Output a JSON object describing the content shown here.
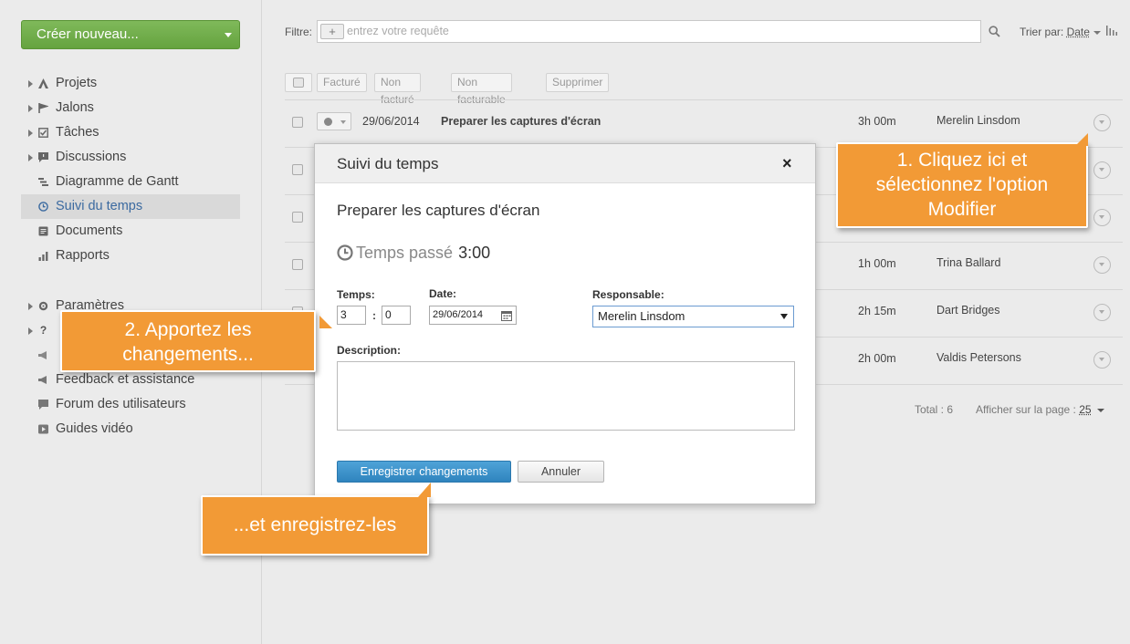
{
  "sidebar": {
    "create_label": "Créer nouveau...",
    "items": [
      {
        "label": "Projets",
        "icon": "project-icon",
        "expandable": true
      },
      {
        "label": "Jalons",
        "icon": "flag-icon",
        "expandable": true
      },
      {
        "label": "Tâches",
        "icon": "checkbox-icon",
        "expandable": true
      },
      {
        "label": "Discussions",
        "icon": "discussion-icon",
        "expandable": true
      },
      {
        "label": "Diagramme de Gantt",
        "icon": "gantt-icon",
        "expandable": false
      },
      {
        "label": "Suivi du temps",
        "icon": "clock-icon",
        "expandable": false,
        "active": true
      },
      {
        "label": "Documents",
        "icon": "document-icon",
        "expandable": false
      },
      {
        "label": "Rapports",
        "icon": "chart-icon",
        "expandable": false
      }
    ],
    "items2": [
      {
        "label": "Paramètres",
        "icon": "gear-icon",
        "expandable": true
      },
      {
        "label": "",
        "icon": "help-icon",
        "expandable": true
      },
      {
        "label": "",
        "icon": "megaphone-icon",
        "expandable": false
      },
      {
        "label": "Feedback et assistance",
        "icon": "megaphone-icon",
        "expandable": false
      },
      {
        "label": "Forum des utilisateurs",
        "icon": "forum-icon",
        "expandable": false
      },
      {
        "label": "Guides vidéo",
        "icon": "video-icon",
        "expandable": false
      }
    ]
  },
  "toolbar": {
    "filter_label": "Filtre:",
    "filter_placeholder": "entrez votre requête",
    "sort_label": "Trier par:",
    "sort_value": "Date"
  },
  "actions": [
    "Facturé",
    "Non facturé",
    "Non facturable",
    "Supprimer"
  ],
  "rows": [
    {
      "date": "29/06/2014",
      "title": "Preparer les captures d'écran",
      "duration": "3h 00m",
      "user": "Merelin Linsdom"
    },
    {
      "date": "",
      "title": "",
      "duration": "",
      "user": ""
    },
    {
      "date": "",
      "title": "",
      "duration": "",
      "user": ""
    },
    {
      "date": "",
      "title": "",
      "duration": "1h 00m",
      "user": "Trina Ballard"
    },
    {
      "date": "",
      "title": "",
      "duration": "2h 15m",
      "user": "Dart Bridges"
    },
    {
      "date": "",
      "title": "",
      "duration": "2h 00m",
      "user": "Valdis Petersons"
    }
  ],
  "footer": {
    "total": "Total : 6",
    "per_page_label": "Afficher sur la page :",
    "per_page_value": "25"
  },
  "modal": {
    "title": "Suivi du temps",
    "close": "×",
    "task_name": "Preparer les captures d'écran",
    "spent_label": "Temps passé",
    "spent_value": "3:00",
    "time_label": "Temps:",
    "hours": "3",
    "colon": ":",
    "minutes": "0",
    "date_label": "Date:",
    "date_value": "29/06/2014",
    "owner_label": "Responsable:",
    "owner_value": "Merelin Linsdom",
    "description_label": "Description:",
    "save_label": "Enregistrer changements",
    "cancel_label": "Annuler"
  },
  "callouts": {
    "c1": [
      "1. Cliquez ici et",
      "sélectionnez l'option",
      "Modifier"
    ],
    "c2": [
      "2. Apportez les",
      "changements..."
    ],
    "c3": "...et enregistrez-les"
  },
  "colors": {
    "accent_green": "#6aa744",
    "callout_orange": "#f29a36",
    "primary_blue": "#2f84be"
  }
}
